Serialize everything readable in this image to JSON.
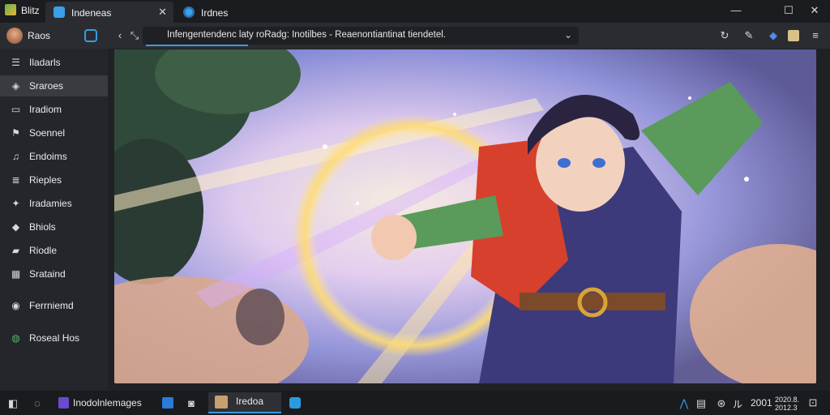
{
  "titlebar": {
    "app_name": "Blitz",
    "tabs": [
      {
        "label": "Indeneas",
        "icon": "window-icon",
        "close": "✕"
      },
      {
        "label": "Irdnes",
        "icon": "browser-icon"
      }
    ],
    "window_controls": {
      "minimize": "—",
      "maximize": "☐",
      "close": "✕"
    }
  },
  "addressbar": {
    "profile_name": "Raos",
    "url_text": "Infengentendenc laty  roRadg: Inotilbes - Reaenontiantinat tiendetel.",
    "dropdown": "⌄"
  },
  "sidebar": {
    "items": [
      {
        "label": "Iladarls",
        "icon": "list-icon",
        "active": false
      },
      {
        "label": "Sraroes",
        "icon": "shield-icon",
        "active": true
      },
      {
        "label": "Iradiom",
        "icon": "book-icon",
        "active": false
      },
      {
        "label": "Soennel",
        "icon": "flag-icon",
        "active": false
      },
      {
        "label": "Endoims",
        "icon": "music-icon",
        "active": false
      },
      {
        "label": "Rieples",
        "icon": "document-icon",
        "active": false
      },
      {
        "label": "Iradamies",
        "icon": "puzzle-icon",
        "active": false
      },
      {
        "label": "Bhiols",
        "icon": "paint-icon",
        "active": false
      },
      {
        "label": "Riodle",
        "icon": "bookmark-icon",
        "active": false
      },
      {
        "label": "Srataind",
        "icon": "calendar-icon",
        "active": false
      },
      {
        "label": "Ferrniemd",
        "icon": "settings-icon",
        "active": false
      },
      {
        "label": "Roseal Hos",
        "icon": "globe-icon",
        "active": false
      }
    ]
  },
  "taskbar": {
    "search_label": "Inodolnlemages",
    "active_label": "Iredoa",
    "tray_time": "2001",
    "tray_chars": "ル",
    "tray_date": "2020.8.",
    "tray_date2": "2012.3"
  },
  "colors": {
    "accent": "#3a9be0",
    "sidebar_bg": "#25262b",
    "active_item": "#3a3b41",
    "taskbar_bg": "#1a1b1f"
  }
}
